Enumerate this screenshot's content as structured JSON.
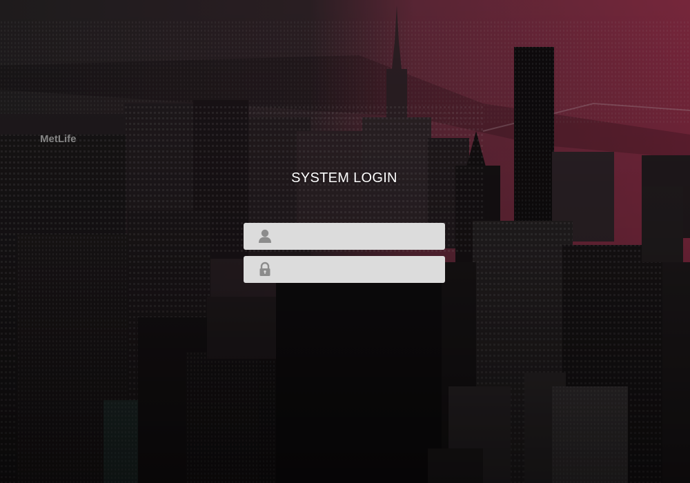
{
  "login": {
    "title": "SYSTEM LOGIN",
    "username_field": {
      "icon": "user-icon",
      "value": "",
      "placeholder": ""
    },
    "password_field": {
      "icon": "lock-icon",
      "value": "",
      "placeholder": ""
    }
  },
  "background": {
    "description_sign": "MetLife",
    "tint_left": "#1c1a1c",
    "tint_right": "#b23a5a"
  }
}
